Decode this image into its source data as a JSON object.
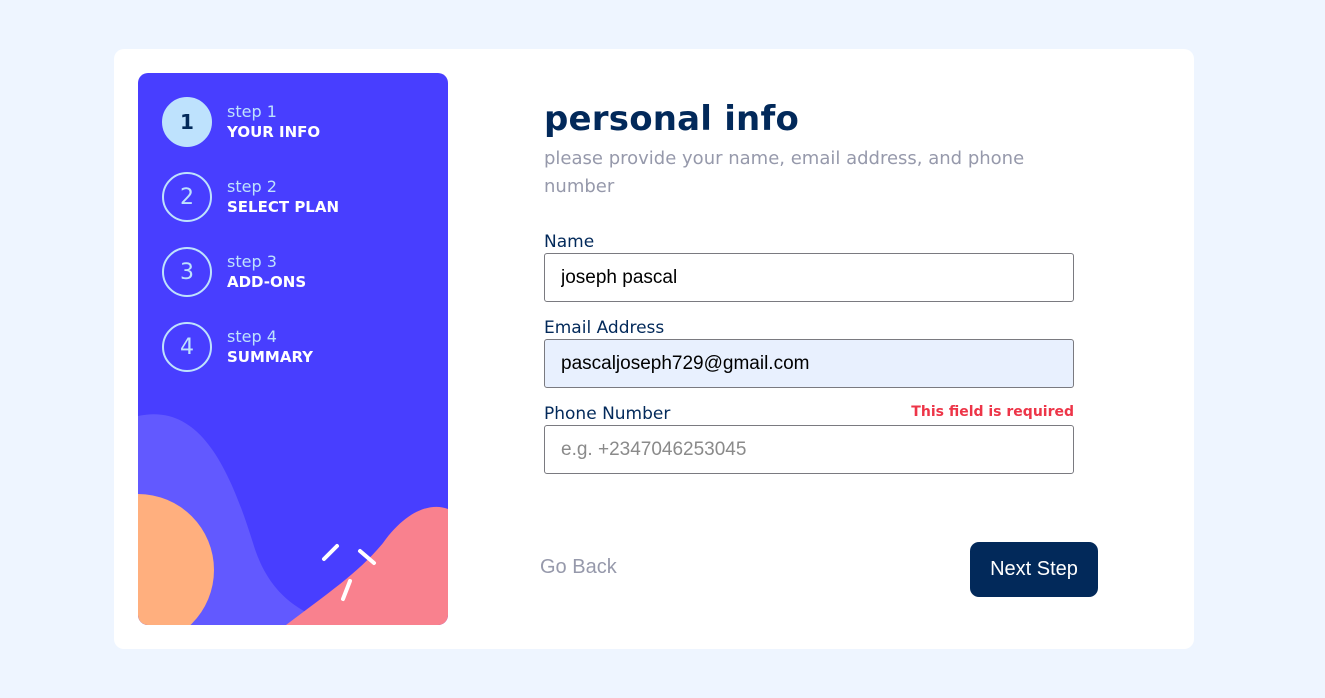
{
  "sidebar": {
    "steps": [
      {
        "number": "1",
        "sub": "step 1",
        "title": "YOUR INFO",
        "active": true
      },
      {
        "number": "2",
        "sub": "step 2",
        "title": "SELECT PLAN",
        "active": false
      },
      {
        "number": "3",
        "sub": "step 3",
        "title": "ADD-ONS",
        "active": false
      },
      {
        "number": "4",
        "sub": "step 4",
        "title": "SUMMARY",
        "active": false
      }
    ]
  },
  "main": {
    "title": "personal info",
    "subtitle": "please provide your name, email address, and phone number",
    "fields": {
      "name": {
        "label": "Name",
        "value": "joseph pascal",
        "placeholder": ""
      },
      "email": {
        "label": "Email Address",
        "value": "pascaljoseph729@gmail.com",
        "placeholder": ""
      },
      "phone": {
        "label": "Phone Number",
        "value": "",
        "placeholder": "e.g. +2347046253045",
        "error": "This field is required"
      }
    }
  },
  "buttons": {
    "back": "Go Back",
    "next": "Next Step"
  },
  "colors": {
    "page_bg": "#eef5ff",
    "sidebar_bg": "#483eff",
    "marine_blue": "#02295a",
    "light_blue": "#bee2fd",
    "cool_gray": "#9699ab",
    "error_red": "#ed3548",
    "orange_shape": "#ffaf7e",
    "pink_shape": "#f9818e",
    "purple_shape": "#6259ff"
  }
}
